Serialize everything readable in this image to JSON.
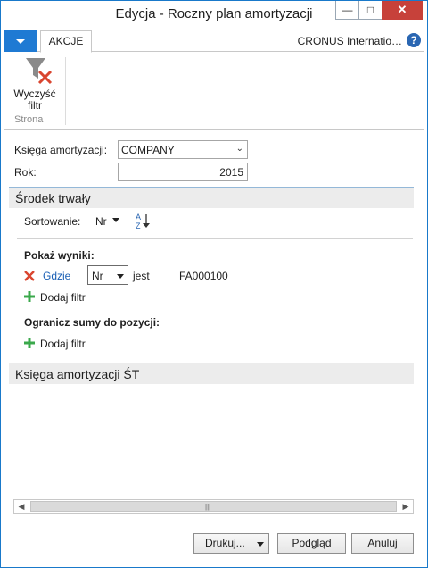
{
  "window": {
    "title": "Edycja - Roczny plan amortyzacji"
  },
  "ribbon": {
    "tab_label": "AKCJE",
    "company": "CRONUS Internatio…",
    "help_glyph": "?",
    "clear_filter_label": "Wyczyść filtr",
    "group_label": "Strona"
  },
  "form": {
    "book_label": "Księga amortyzacji:",
    "book_value": "COMPANY",
    "year_label": "Rok:",
    "year_value": "2015"
  },
  "fixed_asset_tab": {
    "title": "Środek trwały",
    "sort_label": "Sortowanie:",
    "sort_value": "Nr",
    "show_results_label": "Pokaż wyniki:",
    "where_label": "Gdzie",
    "filter_field": "Nr",
    "is_label": "jest",
    "filter_value": "FA000100",
    "add_filter_label": "Dodaj filtr",
    "limit_totals_label": "Ogranicz sumy do pozycji:",
    "add_filter_label_2": "Dodaj filtr"
  },
  "fa_ledger_tab": {
    "title": "Księga amortyzacji ŚT"
  },
  "buttons": {
    "print": "Drukuj...",
    "preview": "Podgląd",
    "cancel": "Anuluj"
  },
  "colors": {
    "accent": "#1f7ad3",
    "close": "#c7413a",
    "remove_x": "#d9452f",
    "add_plus": "#3aa84b",
    "link": "#1a5fb4"
  },
  "icons": [
    "filter-clear-icon",
    "help-icon",
    "sort-az-icon",
    "remove-filter-icon",
    "add-filter-icon",
    "chevron-down-icon"
  ]
}
